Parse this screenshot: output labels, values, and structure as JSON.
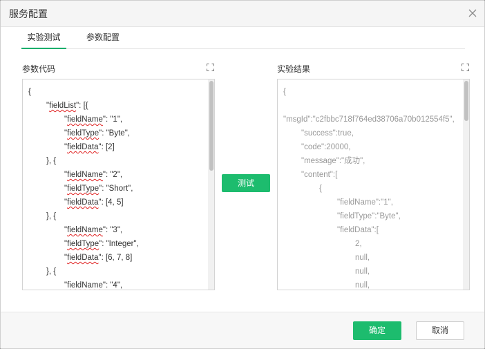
{
  "dialog": {
    "title": "服务配置",
    "close_icon": "close-icon"
  },
  "tabs": [
    {
      "label": "实验测试",
      "active": true
    },
    {
      "label": "参数配置",
      "active": false
    }
  ],
  "params": {
    "label": "参数代码",
    "expand_icon": "expand-icon",
    "lines": [
      {
        "indent": 0,
        "parts": [
          {
            "t": "{"
          }
        ]
      },
      {
        "indent": 1,
        "parts": [
          {
            "t": "\""
          },
          {
            "t": "fieldList",
            "spell": true
          },
          {
            "t": "\": [{"
          }
        ]
      },
      {
        "indent": 2,
        "parts": [
          {
            "t": "\""
          },
          {
            "t": "fieldName",
            "spell": true
          },
          {
            "t": "\": \"1\","
          }
        ]
      },
      {
        "indent": 2,
        "parts": [
          {
            "t": "\""
          },
          {
            "t": "fieldType",
            "spell": true
          },
          {
            "t": "\": \"Byte\","
          }
        ]
      },
      {
        "indent": 2,
        "parts": [
          {
            "t": "\""
          },
          {
            "t": "fieldData",
            "spell": true
          },
          {
            "t": "\": [2]"
          }
        ]
      },
      {
        "indent": 1,
        "parts": [
          {
            "t": "}, {"
          }
        ]
      },
      {
        "indent": 2,
        "parts": [
          {
            "t": "\""
          },
          {
            "t": "fieldName",
            "spell": true
          },
          {
            "t": "\": \"2\","
          }
        ]
      },
      {
        "indent": 2,
        "parts": [
          {
            "t": "\""
          },
          {
            "t": "fieldType",
            "spell": true
          },
          {
            "t": "\": \"Short\","
          }
        ]
      },
      {
        "indent": 2,
        "parts": [
          {
            "t": "\""
          },
          {
            "t": "fieldData",
            "spell": true
          },
          {
            "t": "\": [4, 5]"
          }
        ]
      },
      {
        "indent": 1,
        "parts": [
          {
            "t": "}, {"
          }
        ]
      },
      {
        "indent": 2,
        "parts": [
          {
            "t": "\""
          },
          {
            "t": "fieldName",
            "spell": true
          },
          {
            "t": "\": \"3\","
          }
        ]
      },
      {
        "indent": 2,
        "parts": [
          {
            "t": "\""
          },
          {
            "t": "fieldType",
            "spell": true
          },
          {
            "t": "\": \"Integer\","
          }
        ]
      },
      {
        "indent": 2,
        "parts": [
          {
            "t": "\""
          },
          {
            "t": "fieldData",
            "spell": true
          },
          {
            "t": "\": [6, 7, 8]"
          }
        ]
      },
      {
        "indent": 1,
        "parts": [
          {
            "t": "}, {"
          }
        ]
      },
      {
        "indent": 2,
        "parts": [
          {
            "t": "\""
          },
          {
            "t": "fieldName",
            "spell": true
          },
          {
            "t": "\": \"4\","
          }
        ]
      }
    ]
  },
  "test_button": {
    "label": "测试"
  },
  "results": {
    "label": "实验结果",
    "expand_icon": "expand-icon",
    "lines": [
      {
        "indent": 0,
        "parts": [
          {
            "t": "{"
          }
        ]
      },
      {
        "indent": 0,
        "parts": [
          {
            "t": ""
          }
        ]
      },
      {
        "indent": 0,
        "parts": [
          {
            "t": "\"msgId\":\"c2fbbc718f764ed38706a70b012554f5\","
          }
        ]
      },
      {
        "indent": 1,
        "parts": [
          {
            "t": "\"success\":true,"
          }
        ]
      },
      {
        "indent": 1,
        "parts": [
          {
            "t": "\"code\":20000,"
          }
        ]
      },
      {
        "indent": 1,
        "parts": [
          {
            "t": "\"message\":\"成功\","
          }
        ]
      },
      {
        "indent": 1,
        "parts": [
          {
            "t": "\"content\":["
          }
        ]
      },
      {
        "indent": 2,
        "parts": [
          {
            "t": "{"
          }
        ]
      },
      {
        "indent": 3,
        "parts": [
          {
            "t": "\"fieldName\":\"1\","
          }
        ]
      },
      {
        "indent": 3,
        "parts": [
          {
            "t": "\"fieldType\":\"Byte\","
          }
        ]
      },
      {
        "indent": 3,
        "parts": [
          {
            "t": "\"fieldData\":["
          }
        ]
      },
      {
        "indent": 4,
        "parts": [
          {
            "t": "2,"
          }
        ]
      },
      {
        "indent": 4,
        "parts": [
          {
            "t": "null,"
          }
        ]
      },
      {
        "indent": 4,
        "parts": [
          {
            "t": "null,"
          }
        ]
      },
      {
        "indent": 4,
        "parts": [
          {
            "t": "null,"
          }
        ]
      }
    ]
  },
  "footer": {
    "ok_label": "确定",
    "cancel_label": "取消"
  },
  "colors": {
    "accent": "#1dbc6e",
    "spellcheck": "#e02020"
  }
}
